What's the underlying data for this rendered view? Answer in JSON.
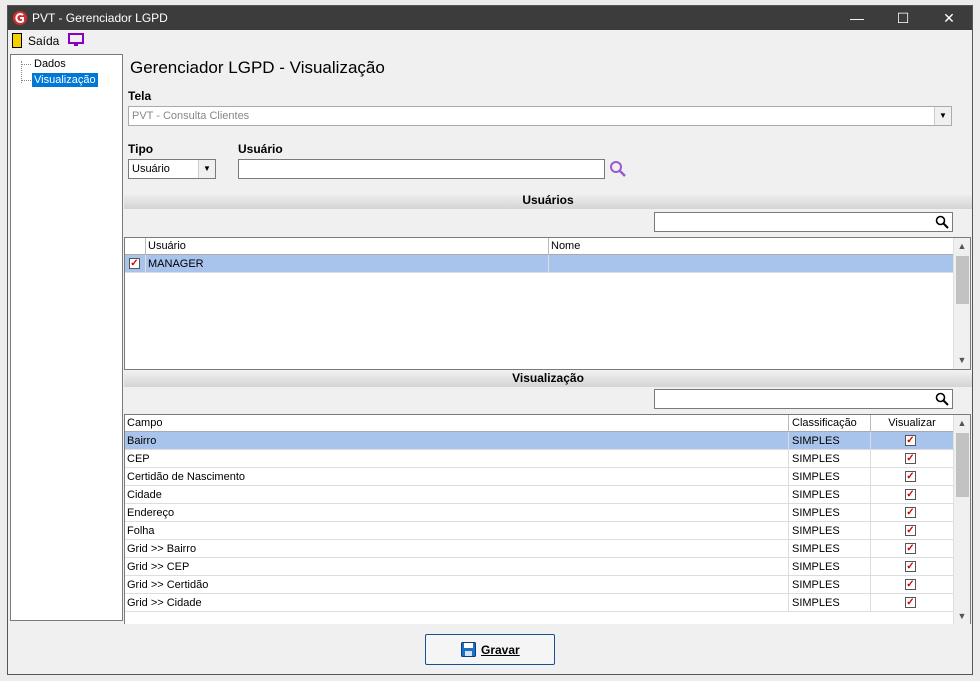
{
  "window": {
    "title": "PVT - Gerenciador LGPD"
  },
  "menu": {
    "exit_label": "Saída"
  },
  "tree": {
    "items": [
      {
        "label": "Dados"
      },
      {
        "label": "Visualização",
        "selected": true
      }
    ]
  },
  "page": {
    "title": "Gerenciador LGPD - Visualização"
  },
  "tela": {
    "label": "Tela",
    "value": "PVT - Consulta Clientes"
  },
  "tipo": {
    "label": "Tipo",
    "value": "Usuário"
  },
  "usuario": {
    "label": "Usuário",
    "value": ""
  },
  "usuarios_section": {
    "title": "Usuários",
    "search_value": "",
    "columns": [
      "Usuário",
      "Nome"
    ],
    "rows": [
      {
        "checked": true,
        "usuario": "MANAGER",
        "nome": ""
      }
    ]
  },
  "visualizacao_section": {
    "title": "Visualização",
    "search_value": "",
    "columns": [
      "Campo",
      "Classificação",
      "Visualizar"
    ],
    "rows": [
      {
        "campo": "Bairro",
        "classificacao": "SIMPLES",
        "visualizar": true
      },
      {
        "campo": "CEP",
        "classificacao": "SIMPLES",
        "visualizar": true
      },
      {
        "campo": "Certidão de Nascimento",
        "classificacao": "SIMPLES",
        "visualizar": true
      },
      {
        "campo": "Cidade",
        "classificacao": "SIMPLES",
        "visualizar": true
      },
      {
        "campo": "Endereço",
        "classificacao": "SIMPLES",
        "visualizar": true
      },
      {
        "campo": "Folha",
        "classificacao": "SIMPLES",
        "visualizar": true
      },
      {
        "campo": "Grid >> Bairro",
        "classificacao": "SIMPLES",
        "visualizar": true
      },
      {
        "campo": "Grid >> CEP",
        "classificacao": "SIMPLES",
        "visualizar": true
      },
      {
        "campo": "Grid >> Certidão",
        "classificacao": "SIMPLES",
        "visualizar": true
      },
      {
        "campo": "Grid >> Cidade",
        "classificacao": "SIMPLES",
        "visualizar": true
      }
    ]
  },
  "footer": {
    "save_label": "Gravar"
  },
  "icons": {
    "app": "app-logo-icon",
    "exit": "exit-door-icon",
    "monitor": "monitor-icon",
    "search": "search-icon",
    "save": "floppy-disk-icon"
  },
  "colors": {
    "titlebar": "#3c3c3c",
    "selection": "#a8c4ec",
    "tree_selection": "#0078d7",
    "check": "#d40000",
    "search_accent": "#9b59d0"
  }
}
